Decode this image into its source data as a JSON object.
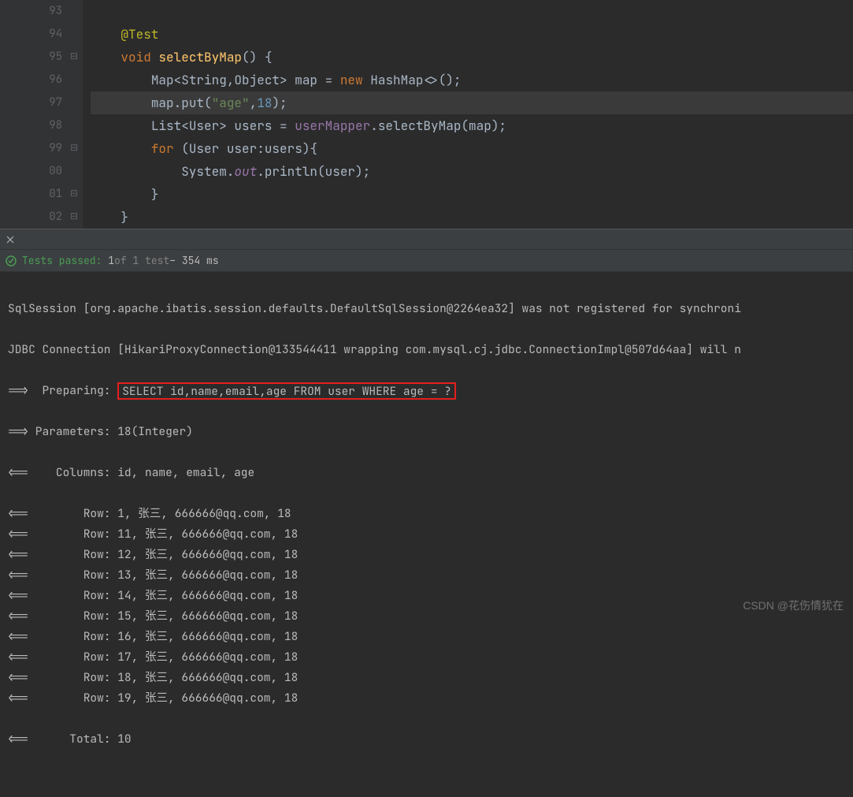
{
  "gutter": {
    "lines": [
      "93",
      "94",
      "95",
      "96",
      "97",
      "98",
      "99",
      "00",
      "01",
      "02"
    ]
  },
  "code": {
    "l94_anno": "@Test",
    "l95_kw": "void",
    "l95_method": "selectByMap",
    "l95_rest": "() {",
    "l96_pre": "Map<String,Object> map = ",
    "l96_kw": "new",
    "l96_post": " HashMap<>();",
    "l97_pre": "map.put(",
    "l97_str": "\"age\"",
    "l97_comma": ",",
    "l97_num": "18",
    "l97_post": ");",
    "l98_pre": "List<User> users = ",
    "l98_field": "userMapper",
    "l98_post": ".selectByMap(map);",
    "l99_for": "for",
    "l99_rest": " (User user:users){",
    "l100_pre": "System.",
    "l100_out": "out",
    "l100_post": ".println(user);",
    "l101": "}",
    "l102": "}"
  },
  "status": {
    "passed": "Tests passed:",
    "count": "1",
    "of": " of 1 test",
    "time": " – 354 ms"
  },
  "console": {
    "l1": "SqlSession [org.apache.ibatis.session.defaults.DefaultSqlSession@2264ea32] was not registered for synchroni",
    "l2": "JDBC Connection [HikariProxyConnection@133544411 wrapping com.mysql.cj.jdbc.ConnectionImpl@507d64aa] will n",
    "l3_pre": "==>  Preparing: ",
    "l3_sql": "SELECT id,name,email,age FROM user WHERE age = ?",
    "l4": "==> Parameters: 18(Integer)",
    "l5": "<==    Columns: id, name, email, age",
    "rows": [
      "<==        Row: 1, 张三, 666666@qq.com, 18",
      "<==        Row: 11, 张三, 666666@qq.com, 18",
      "<==        Row: 12, 张三, 666666@qq.com, 18",
      "<==        Row: 13, 张三, 666666@qq.com, 18",
      "<==        Row: 14, 张三, 666666@qq.com, 18",
      "<==        Row: 15, 张三, 666666@qq.com, 18",
      "<==        Row: 16, 张三, 666666@qq.com, 18",
      "<==        Row: 17, 张三, 666666@qq.com, 18",
      "<==        Row: 18, 张三, 666666@qq.com, 18",
      "<==        Row: 19, 张三, 666666@qq.com, 18"
    ],
    "total": "<==      Total: 10"
  },
  "watermark": "CSDN @花伤情犹在"
}
